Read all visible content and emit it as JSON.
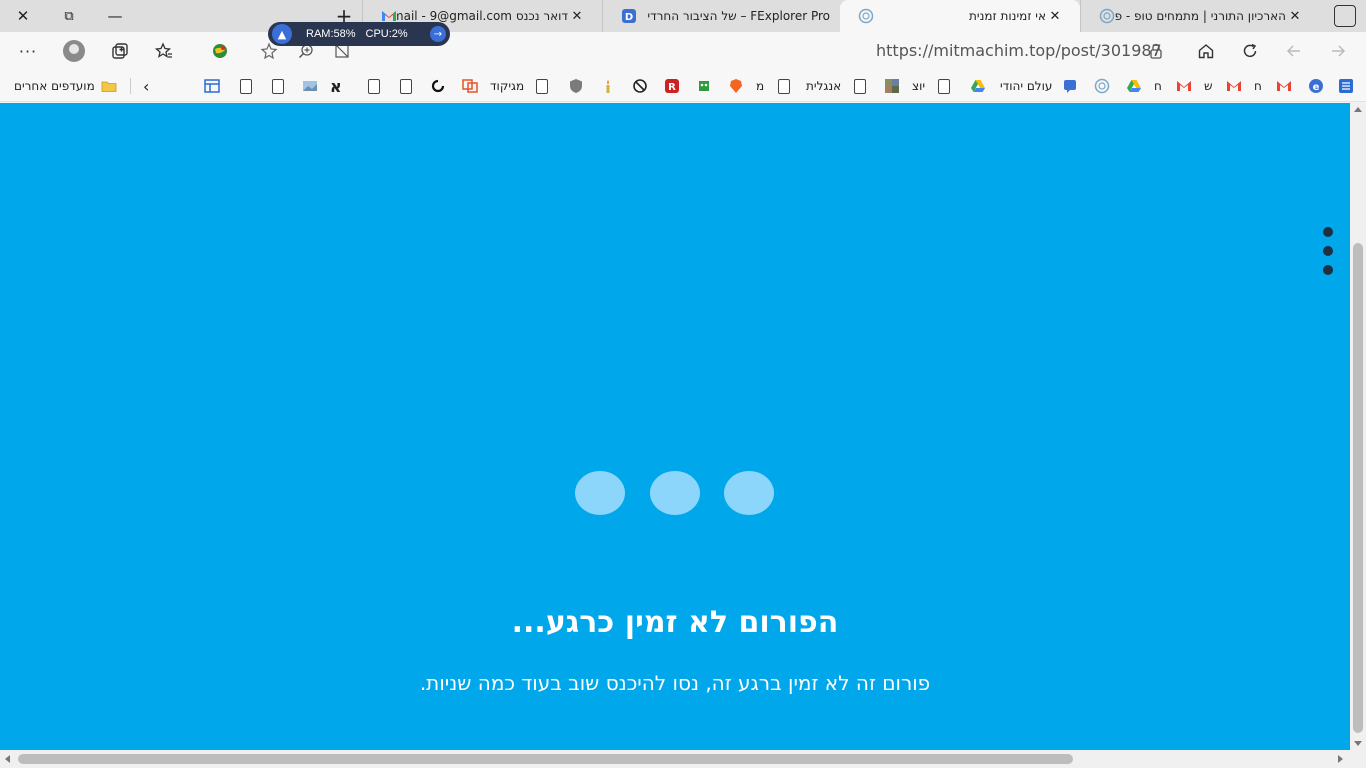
{
  "window": {
    "close": "✕",
    "restore": "⧉",
    "minimize": "—"
  },
  "new_tab": "+",
  "tabs": [
    {
      "title": "דואר נכנס Gmail - 9@gmail.com",
      "close": "✕",
      "favicon": "gmail-icon"
    },
    {
      "title": "FExplorer Pro – של הציבור החרדי",
      "close": "",
      "favicon": "fexplorer-icon"
    },
    {
      "title": "אי זמינות זמנית",
      "close": "✕",
      "favicon": "forum-icon"
    },
    {
      "title": "הארכיון התורני | מתמחים טופ - פ",
      "close": "✕",
      "favicon": "forum-icon"
    }
  ],
  "system_monitor": {
    "ram": "RAM:58%",
    "cpu": "CPU:2%"
  },
  "toolbar": {
    "more": "···",
    "url": "https://mitmachim.top/post/301987"
  },
  "bookmarks": {
    "other_favorites": "מועדפים אחרים",
    "chevron": "‹",
    "aleph": "א",
    "magikod": "מגיקוד",
    "mem": "מ",
    "anglit": "אנגלית",
    "yotz": "יוצ",
    "olam_yehudi": "עולם יהודי",
    "chet1": "ח",
    "shin": "ש",
    "chet2": "ח"
  },
  "content": {
    "headline": "הפורום לא זמין כרגע...",
    "subline": "פורום זה לא זמין ברגע זה, נסו להיכנס שוב בעוד כמה שניות."
  },
  "colors": {
    "background": "#00a7eb",
    "loader_dot": "#8cd6fb",
    "menu_dot": "#1f3040"
  }
}
